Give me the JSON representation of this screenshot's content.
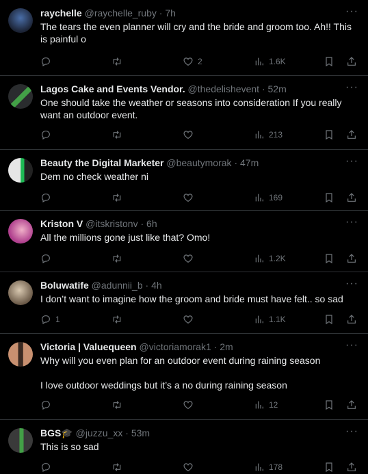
{
  "tweets": [
    {
      "name": "raychelle",
      "handle": "@raychelle_ruby",
      "time": "7h",
      "text": [
        "The tears the even planner will cry and the bride and groom too. Ah!! This is painful o"
      ],
      "replies": "",
      "retweets": "",
      "likes": "2",
      "views": "1.6K",
      "avatar_colors": [
        "#1c2436",
        "#4a6ea8"
      ]
    },
    {
      "name": "Lagos Cake and Events Vendor.",
      "handle": "@thedelishevent",
      "time": "52m",
      "text": [
        "One should take the weather or seasons into consideration If you really want an outdoor event."
      ],
      "replies": "",
      "retweets": "",
      "likes": "",
      "views": "213",
      "avatar_colors": [
        "#2a2c2e",
        "#43a047"
      ]
    },
    {
      "name": "Beauty the Digital Marketer",
      "handle": "@beautymorak",
      "time": "47m",
      "text": [
        "Dem no check weather ni"
      ],
      "replies": "",
      "retweets": "",
      "likes": "",
      "views": "169",
      "avatar_colors": [
        "#e6e6e6",
        "#1db954"
      ]
    },
    {
      "name": "Kriston V",
      "handle": "@itskristonv",
      "time": "6h",
      "text": [
        "All the millions gone just like that? Omo!"
      ],
      "replies": "",
      "retweets": "",
      "likes": "",
      "views": "1.2K",
      "avatar_colors": [
        "#b0408e",
        "#f0b0c8"
      ]
    },
    {
      "name": "Boluwatife",
      "handle": "@adunnii_b",
      "time": "4h",
      "text": [
        "I don’t want to imagine how the groom and bride must have felt.. so sad"
      ],
      "replies": "1",
      "retweets": "",
      "likes": "",
      "views": "1.1K",
      "avatar_colors": [
        "#6b5a48",
        "#d8c8b0"
      ]
    },
    {
      "name": "Victoria | Valuequeen",
      "handle": "@victoriamorak1",
      "time": "2m",
      "text": [
        "Why will you even plan for an outdoor event during raining season",
        "I love outdoor weddings but it’s a no during raining season"
      ],
      "replies": "",
      "retweets": "",
      "likes": "",
      "views": "12",
      "avatar_colors": [
        "#3a2a22",
        "#c89070"
      ]
    },
    {
      "name": "BGS🎓",
      "handle": "@juzzu_xx",
      "time": "53m",
      "text": [
        "This is so sad"
      ],
      "replies": "",
      "retweets": "",
      "likes": "",
      "views": "178",
      "avatar_colors": [
        "#3a3a3a",
        "#43a047"
      ]
    }
  ],
  "more_label": "···",
  "separator": "·"
}
